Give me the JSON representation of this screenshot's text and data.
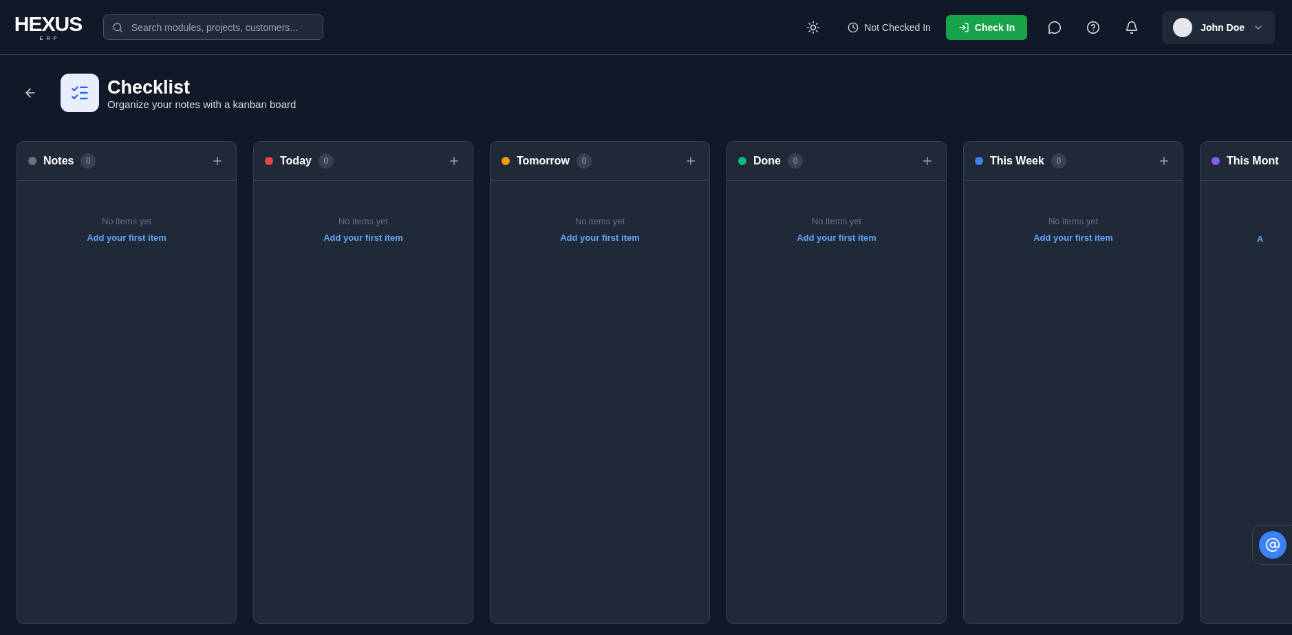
{
  "logo": {
    "name": "HEXUS",
    "tagline": "ERP"
  },
  "search": {
    "placeholder": "Search modules, projects, customers..."
  },
  "attendance": {
    "status": "Not Checked In",
    "button": "Check In"
  },
  "user": {
    "name": "John Doe"
  },
  "page": {
    "title": "Checklist",
    "subtitle": "Organize your notes with a kanban board"
  },
  "columns": [
    {
      "title": "Notes",
      "color": "#6b7280",
      "count": "0",
      "empty_text": "No items yet",
      "add_link": "Add your first item"
    },
    {
      "title": "Today",
      "color": "#ef4444",
      "count": "0",
      "empty_text": "No items yet",
      "add_link": "Add your first item"
    },
    {
      "title": "Tomorrow",
      "color": "#f59e0b",
      "count": "0",
      "empty_text": "No items yet",
      "add_link": "Add your first item"
    },
    {
      "title": "Done",
      "color": "#10b981",
      "count": "0",
      "empty_text": "No items yet",
      "add_link": "Add your first item"
    },
    {
      "title": "This Week",
      "color": "#3b82f6",
      "count": "0",
      "empty_text": "No items yet",
      "add_link": "Add your first item"
    },
    {
      "title": "This Mont",
      "color": "#8b5cf6",
      "add_link": "A"
    }
  ]
}
